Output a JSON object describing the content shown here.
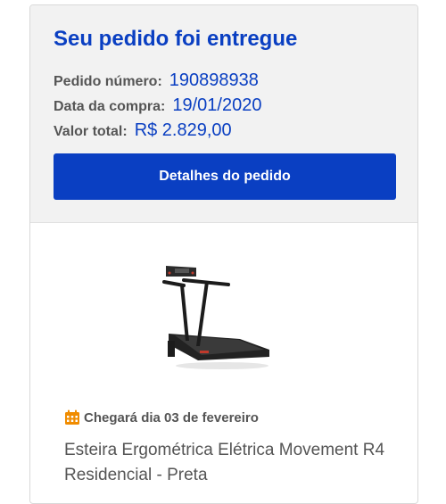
{
  "order": {
    "title": "Seu pedido foi entregue",
    "number_label": "Pedido número:",
    "number_value": "190898938",
    "date_label": "Data da compra:",
    "date_value": "19/01/2020",
    "total_label": "Valor total:",
    "total_value": "R$ 2.829,00",
    "details_button": "Detalhes do pedido"
  },
  "product": {
    "delivery_icon": "calendar-icon",
    "delivery_text": "Chegará dia 03 de fevereiro",
    "name": "Esteira Ergométrica Elétrica Movement R4 Residencial - Preta"
  },
  "colors": {
    "accent": "#0a3fc2",
    "delivery_icon": "#f08c00",
    "summary_bg": "#f2f2f2"
  }
}
